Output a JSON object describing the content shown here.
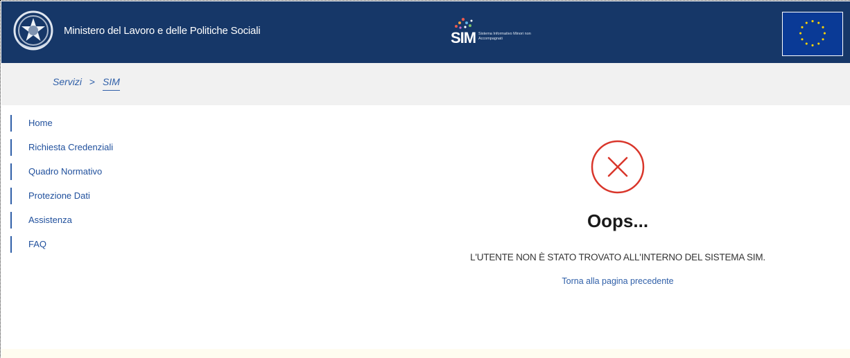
{
  "header": {
    "ministry_title": "Ministero del Lavoro e delle Politiche Sociali",
    "sim_logo_text": "SIM",
    "sim_logo_subtitle": "Sistema Informativo Minori non Accompagnati",
    "emblem_icon": "italian-republic-emblem-icon",
    "eu_flag_icon": "eu-flag-icon",
    "background_color": "#163768"
  },
  "breadcrumb": {
    "items": [
      "Servizi",
      "SIM"
    ],
    "separator": ">"
  },
  "sidebar": {
    "items": [
      {
        "label": "Home"
      },
      {
        "label": "Richiesta Credenziali"
      },
      {
        "label": "Quadro Normativo"
      },
      {
        "label": "Protezione Dati"
      },
      {
        "label": "Assistenza"
      },
      {
        "label": "FAQ"
      }
    ]
  },
  "main": {
    "error_icon": "circle-x-icon",
    "error_color": "#d9362b",
    "title": "Oops...",
    "message": "L'UTENTE NON È STATO TROVATO ALL'INTERNO DEL SISTEMA SIM.",
    "back_link": "Torna alla pagina precedente"
  }
}
